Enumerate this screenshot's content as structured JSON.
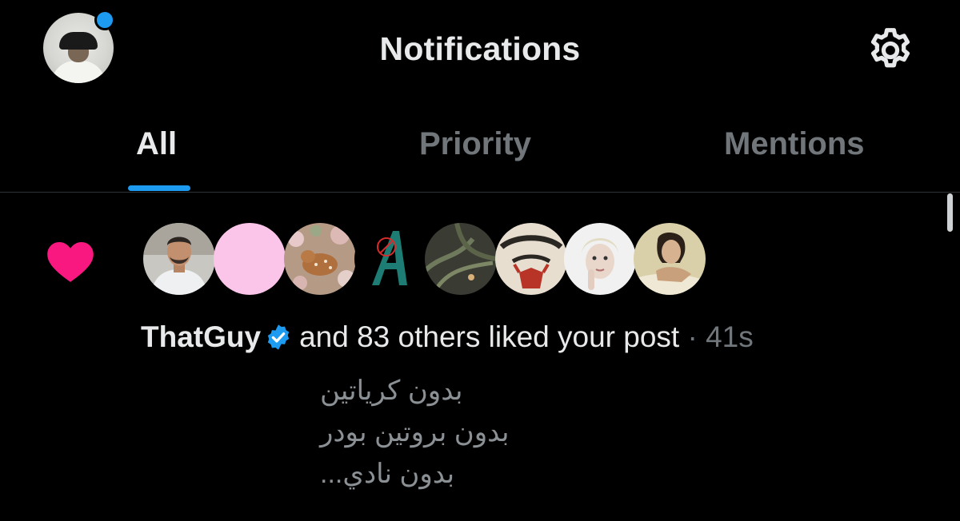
{
  "header": {
    "title": "Notifications",
    "avatar_icon": "profile-avatar",
    "settings_icon": "gear-icon",
    "unread_dot_color": "#1d9bf0"
  },
  "tabs": [
    {
      "label": "All",
      "active": true
    },
    {
      "label": "Priority",
      "active": false
    },
    {
      "label": "Mentions",
      "active": false
    }
  ],
  "notification": {
    "type_icon": "heart-icon",
    "type_color": "#f91880",
    "likers": [
      "man-in-white-shirt-avatar",
      "pink-avatar",
      "fawn-in-flowers-avatar",
      "green-letter-a-avatar",
      "palm-leaves-avatar",
      "hellfire-club-avatar",
      "blonde-woman-avatar",
      "vintage-woman-avatar"
    ],
    "user_name": "ThatGuy",
    "verified": true,
    "summary_text": "and 83 others liked your post",
    "separator": "·",
    "time": "41s",
    "post_lines": [
      "بدون كرياتين",
      "بدون بروتين بودر",
      "بدون نادي..."
    ]
  },
  "colors": {
    "background": "#000000",
    "accent": "#1d9bf0",
    "like": "#f91880",
    "primary_text": "#e7e9ea",
    "secondary_text": "#71767b"
  }
}
